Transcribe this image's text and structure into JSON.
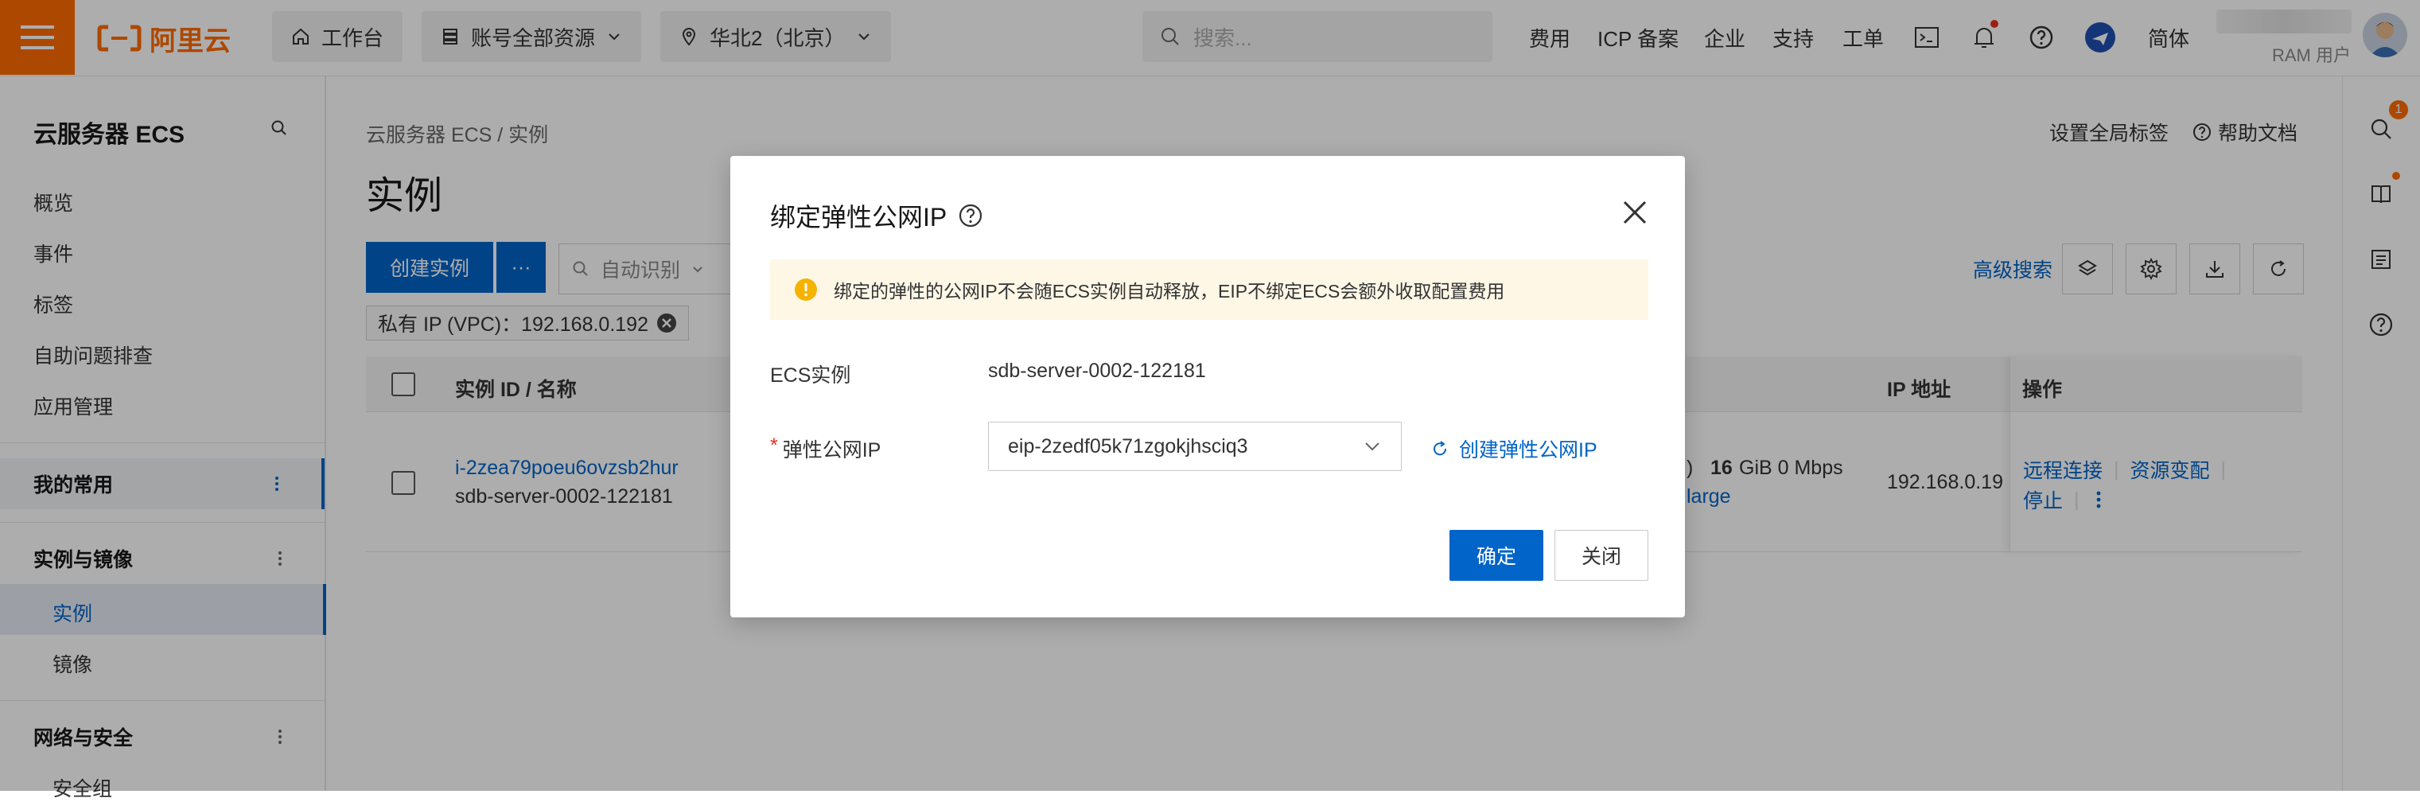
{
  "topbar": {
    "logo_text": "阿里云",
    "workbench": "工作台",
    "resources": "账号全部资源",
    "region": "华北2（北京）",
    "search_placeholder": "搜索...",
    "nav": [
      "费用",
      "ICP 备案",
      "企业",
      "支持",
      "工单"
    ],
    "lang": "简体",
    "user_role": "RAM 用户",
    "brand_color": "#ff6a00"
  },
  "sidebar": {
    "title": "云服务器 ECS",
    "items": [
      "概览",
      "事件",
      "标签",
      "自助问题排查",
      "应用管理"
    ],
    "groups": {
      "favorites": "我的常用",
      "instances_images": "实例与镜像",
      "network_security": "网络与安全"
    },
    "sub_items": [
      "实例",
      "镜像"
    ],
    "partial_item": "安全组"
  },
  "main": {
    "breadcrumb": "云服务器 ECS  /  实例",
    "title": "实例",
    "global_tags": "设置全局标签",
    "help_docs": "帮助文档",
    "create_instance": "创建实例",
    "more": "···",
    "filter_placeholder": "自动识别",
    "chip_label": "私有 IP (VPC)：192.168.0.192",
    "advanced_search": "高级搜索",
    "table": {
      "headers": [
        "实例 ID / 名称",
        "IP 地址",
        "操作"
      ],
      "row": {
        "id": "i-2zea79poeu6ovzsb2hur",
        "name": "sdb-server-0002-122181",
        "spec_suffix": ")",
        "memory": "16",
        "memory_unit": "GiB 0 Mbps",
        "type_suffix": "large",
        "ip": "192.168.0.19",
        "ops": [
          "远程连接",
          "资源变配",
          "停止"
        ]
      }
    }
  },
  "modal": {
    "title": "绑定弹性公网IP",
    "alert": "绑定的弹性的公网IP不会随ECS实例自动释放，EIP不绑定ECS会额外收取配置费用",
    "instance_label": "ECS实例",
    "instance_value": "sdb-server-0002-122181",
    "required_mark": "*",
    "eip_label": "弹性公网IP",
    "eip_value": "eip-2zedf05k71zgokjhsciq3",
    "create_eip": "创建弹性公网IP",
    "ok": "确定",
    "close": "关闭"
  },
  "rail": {
    "badge": "1"
  },
  "colors": {
    "primary": "#0064c8",
    "warning_bg": "#fef7e6",
    "warning_icon": "#f5b300"
  }
}
